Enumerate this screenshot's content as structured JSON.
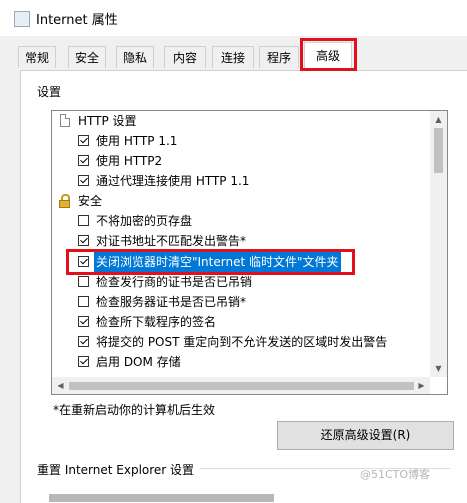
{
  "window": {
    "title": "Internet 属性"
  },
  "tabs": [
    {
      "label": "常规"
    },
    {
      "label": "安全"
    },
    {
      "label": "隐私"
    },
    {
      "label": "内容"
    },
    {
      "label": "连接"
    },
    {
      "label": "程序"
    },
    {
      "label": "高级",
      "selected": true
    }
  ],
  "settings": {
    "group_label": "设置",
    "items": [
      {
        "type": "category",
        "icon": "document-icon",
        "label": "HTTP 设置"
      },
      {
        "type": "checkbox",
        "checked": true,
        "label": "使用 HTTP 1.1"
      },
      {
        "type": "checkbox",
        "checked": true,
        "label": "使用 HTTP2"
      },
      {
        "type": "checkbox",
        "checked": true,
        "label": "通过代理连接使用 HTTP 1.1"
      },
      {
        "type": "category",
        "icon": "lock-icon",
        "label": "安全"
      },
      {
        "type": "checkbox",
        "checked": false,
        "label": "不将加密的页存盘"
      },
      {
        "type": "checkbox",
        "checked": true,
        "label": "对证书地址不匹配发出警告*"
      },
      {
        "type": "checkbox",
        "checked": true,
        "highlighted": true,
        "label": "关闭浏览器时清空\"Internet 临时文件\"文件夹"
      },
      {
        "type": "checkbox",
        "checked": false,
        "label": "检查发行商的证书是否已吊销"
      },
      {
        "type": "checkbox",
        "checked": false,
        "label": "检查服务器证书是否已吊销*"
      },
      {
        "type": "checkbox",
        "checked": true,
        "label": "检查所下载程序的签名"
      },
      {
        "type": "checkbox",
        "checked": true,
        "label": "将提交的 POST 重定向到不允许发送的区域时发出警告"
      },
      {
        "type": "checkbox",
        "checked": true,
        "label": "启用 DOM 存储"
      }
    ]
  },
  "restart_note": "*在重新启动你的计算机后生效",
  "reset_advanced_button": "还原高级设置(R)",
  "reset_ie_group_label": "重置 Internet Explorer 设置",
  "watermark": "@51CTO博客",
  "colors": {
    "highlight_border": "#e0101c",
    "selection": "#0078d7"
  }
}
